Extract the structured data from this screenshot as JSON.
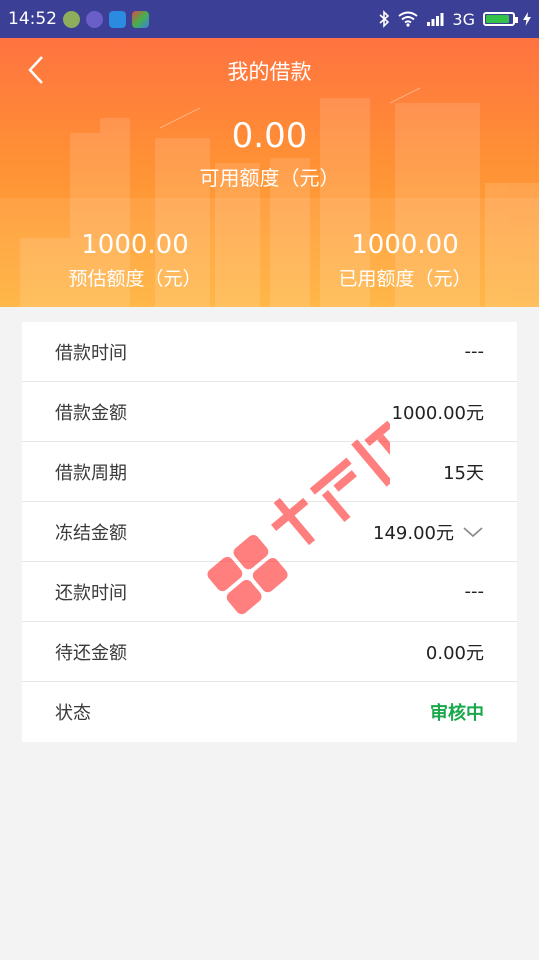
{
  "status_bar": {
    "time": "14:52",
    "network": "3G",
    "icons": [
      "add-circle-icon",
      "search-circle-icon",
      "scan-icon",
      "maps-icon",
      "bluetooth-icon",
      "wifi-icon",
      "signal-icon",
      "battery-icon"
    ],
    "battery_level": 0.9
  },
  "header": {
    "title": "我的借款",
    "available_amount": "0.00",
    "available_label": "可用额度（元）",
    "estimated_amount": "1000.00",
    "estimated_label": "预估额度（元）",
    "used_amount": "1000.00",
    "used_label": "已用额度（元）"
  },
  "details": [
    {
      "label": "借款时间",
      "value": "---"
    },
    {
      "label": "借款金额",
      "value": "1000.00元"
    },
    {
      "label": "借款周期",
      "value": "15天"
    },
    {
      "label": "冻结金额",
      "value": "149.00元"
    },
    {
      "label": "还款时间",
      "value": "---"
    },
    {
      "label": "待还金额",
      "value": "0.00元"
    },
    {
      "label": "状态",
      "value": "审核中"
    }
  ],
  "colors": {
    "status_bar": "#3b3f95",
    "header_top": "#ff7340",
    "header_bottom": "#ffb23a",
    "status_green": "#19a84b",
    "watermark_red": "#ff3b3b"
  }
}
